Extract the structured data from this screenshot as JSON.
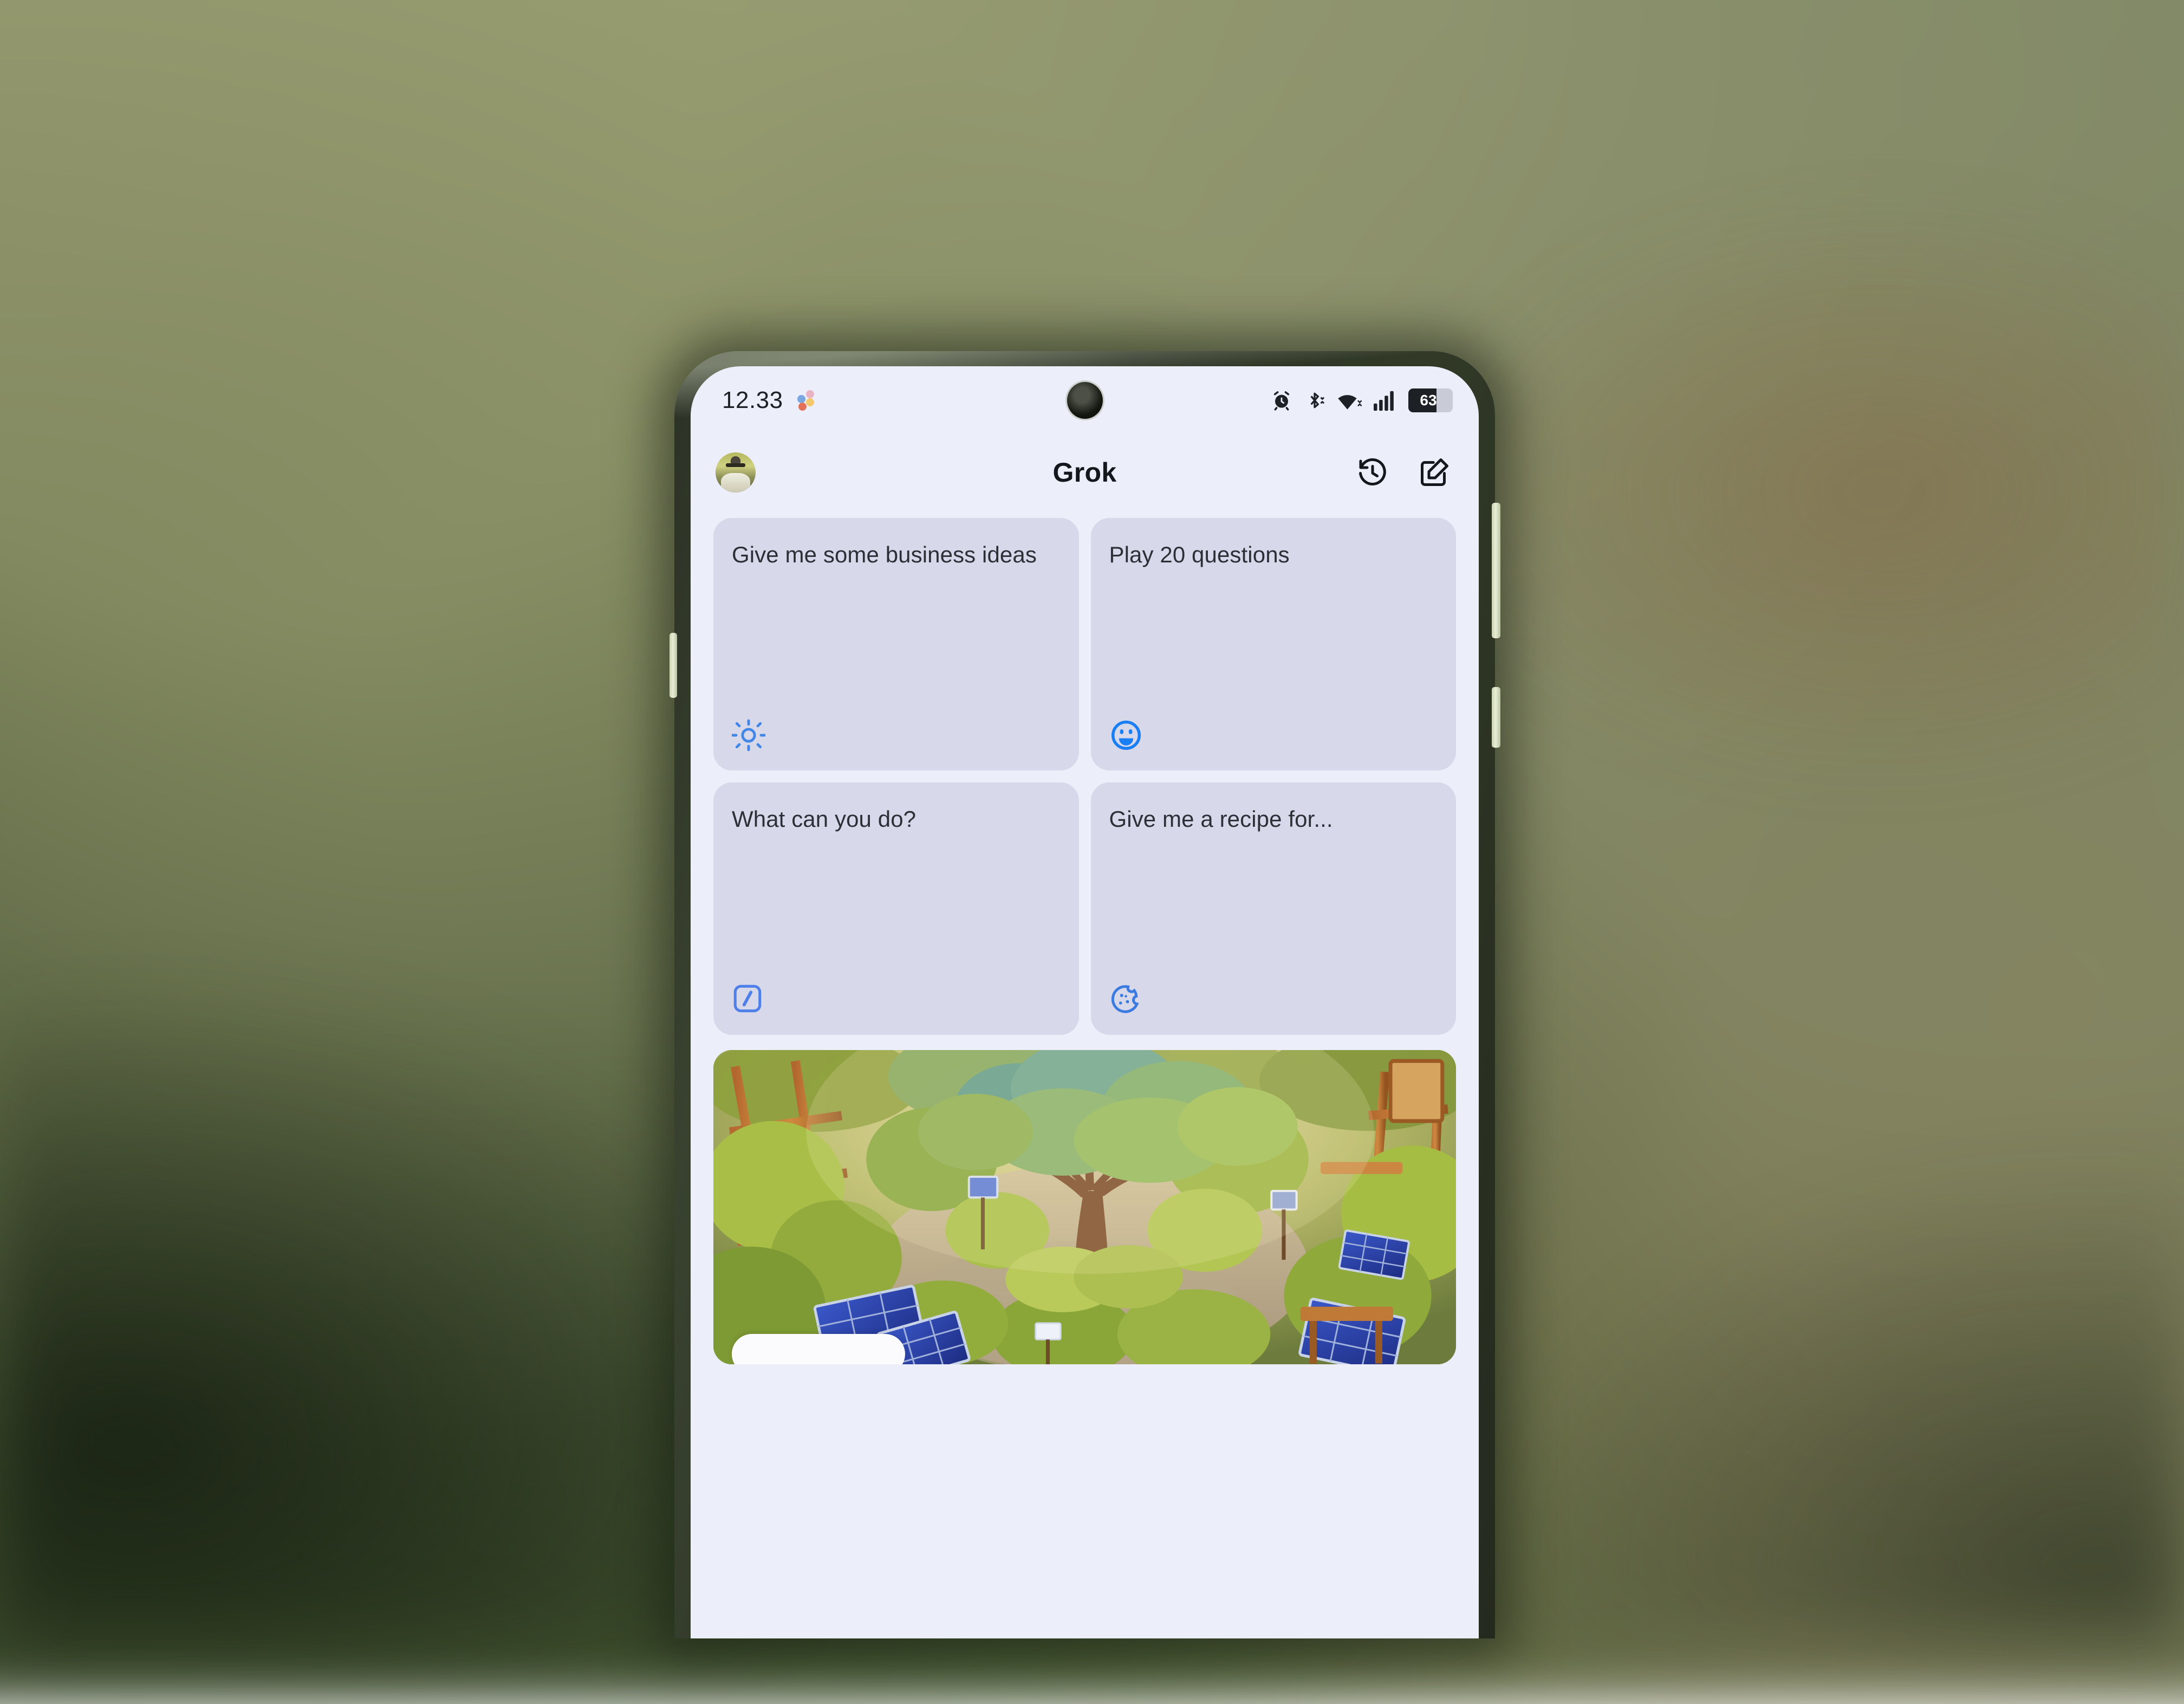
{
  "device": {
    "frame_color": "#2d3427",
    "side_buttons": [
      "volume-rocker",
      "power-button",
      "left-button"
    ]
  },
  "status_bar": {
    "time": "12.33",
    "assistant_dots_icon": "google-assistant-dots-icon",
    "icons": [
      "alarm-icon",
      "bluetooth-icon",
      "wifi-icon",
      "cellular-signal-icon"
    ],
    "battery_percent": "63",
    "battery_level": 63
  },
  "app_bar": {
    "title": "Grok",
    "avatar_icon": "user-avatar",
    "history_icon": "history-clock-icon",
    "compose_icon": "new-chat-compose-icon"
  },
  "suggestion_cards": [
    {
      "text": "Give me some business ideas",
      "icon": "sun-idea-icon",
      "icon_color": "#4287e8"
    },
    {
      "text": "Play 20 questions",
      "icon": "smiley-face-icon",
      "icon_color": "#1a7ef5"
    },
    {
      "text": "What can you do?",
      "icon": "slash-command-icon",
      "icon_color": "#4f7fe8"
    },
    {
      "text": "Give me a recipe for...",
      "icon": "cookie-icon",
      "icon_color": "#3b7ae0"
    }
  ],
  "hero": {
    "alt": "generated-image-eco-garden-with-large-tree-and-solar-panels",
    "chip_label": ""
  },
  "colors": {
    "screen_background": "#eceef9",
    "card_background": "#d7d9ea",
    "text_primary": "#2b2f36",
    "accent_blue": "#3b7ae0"
  }
}
